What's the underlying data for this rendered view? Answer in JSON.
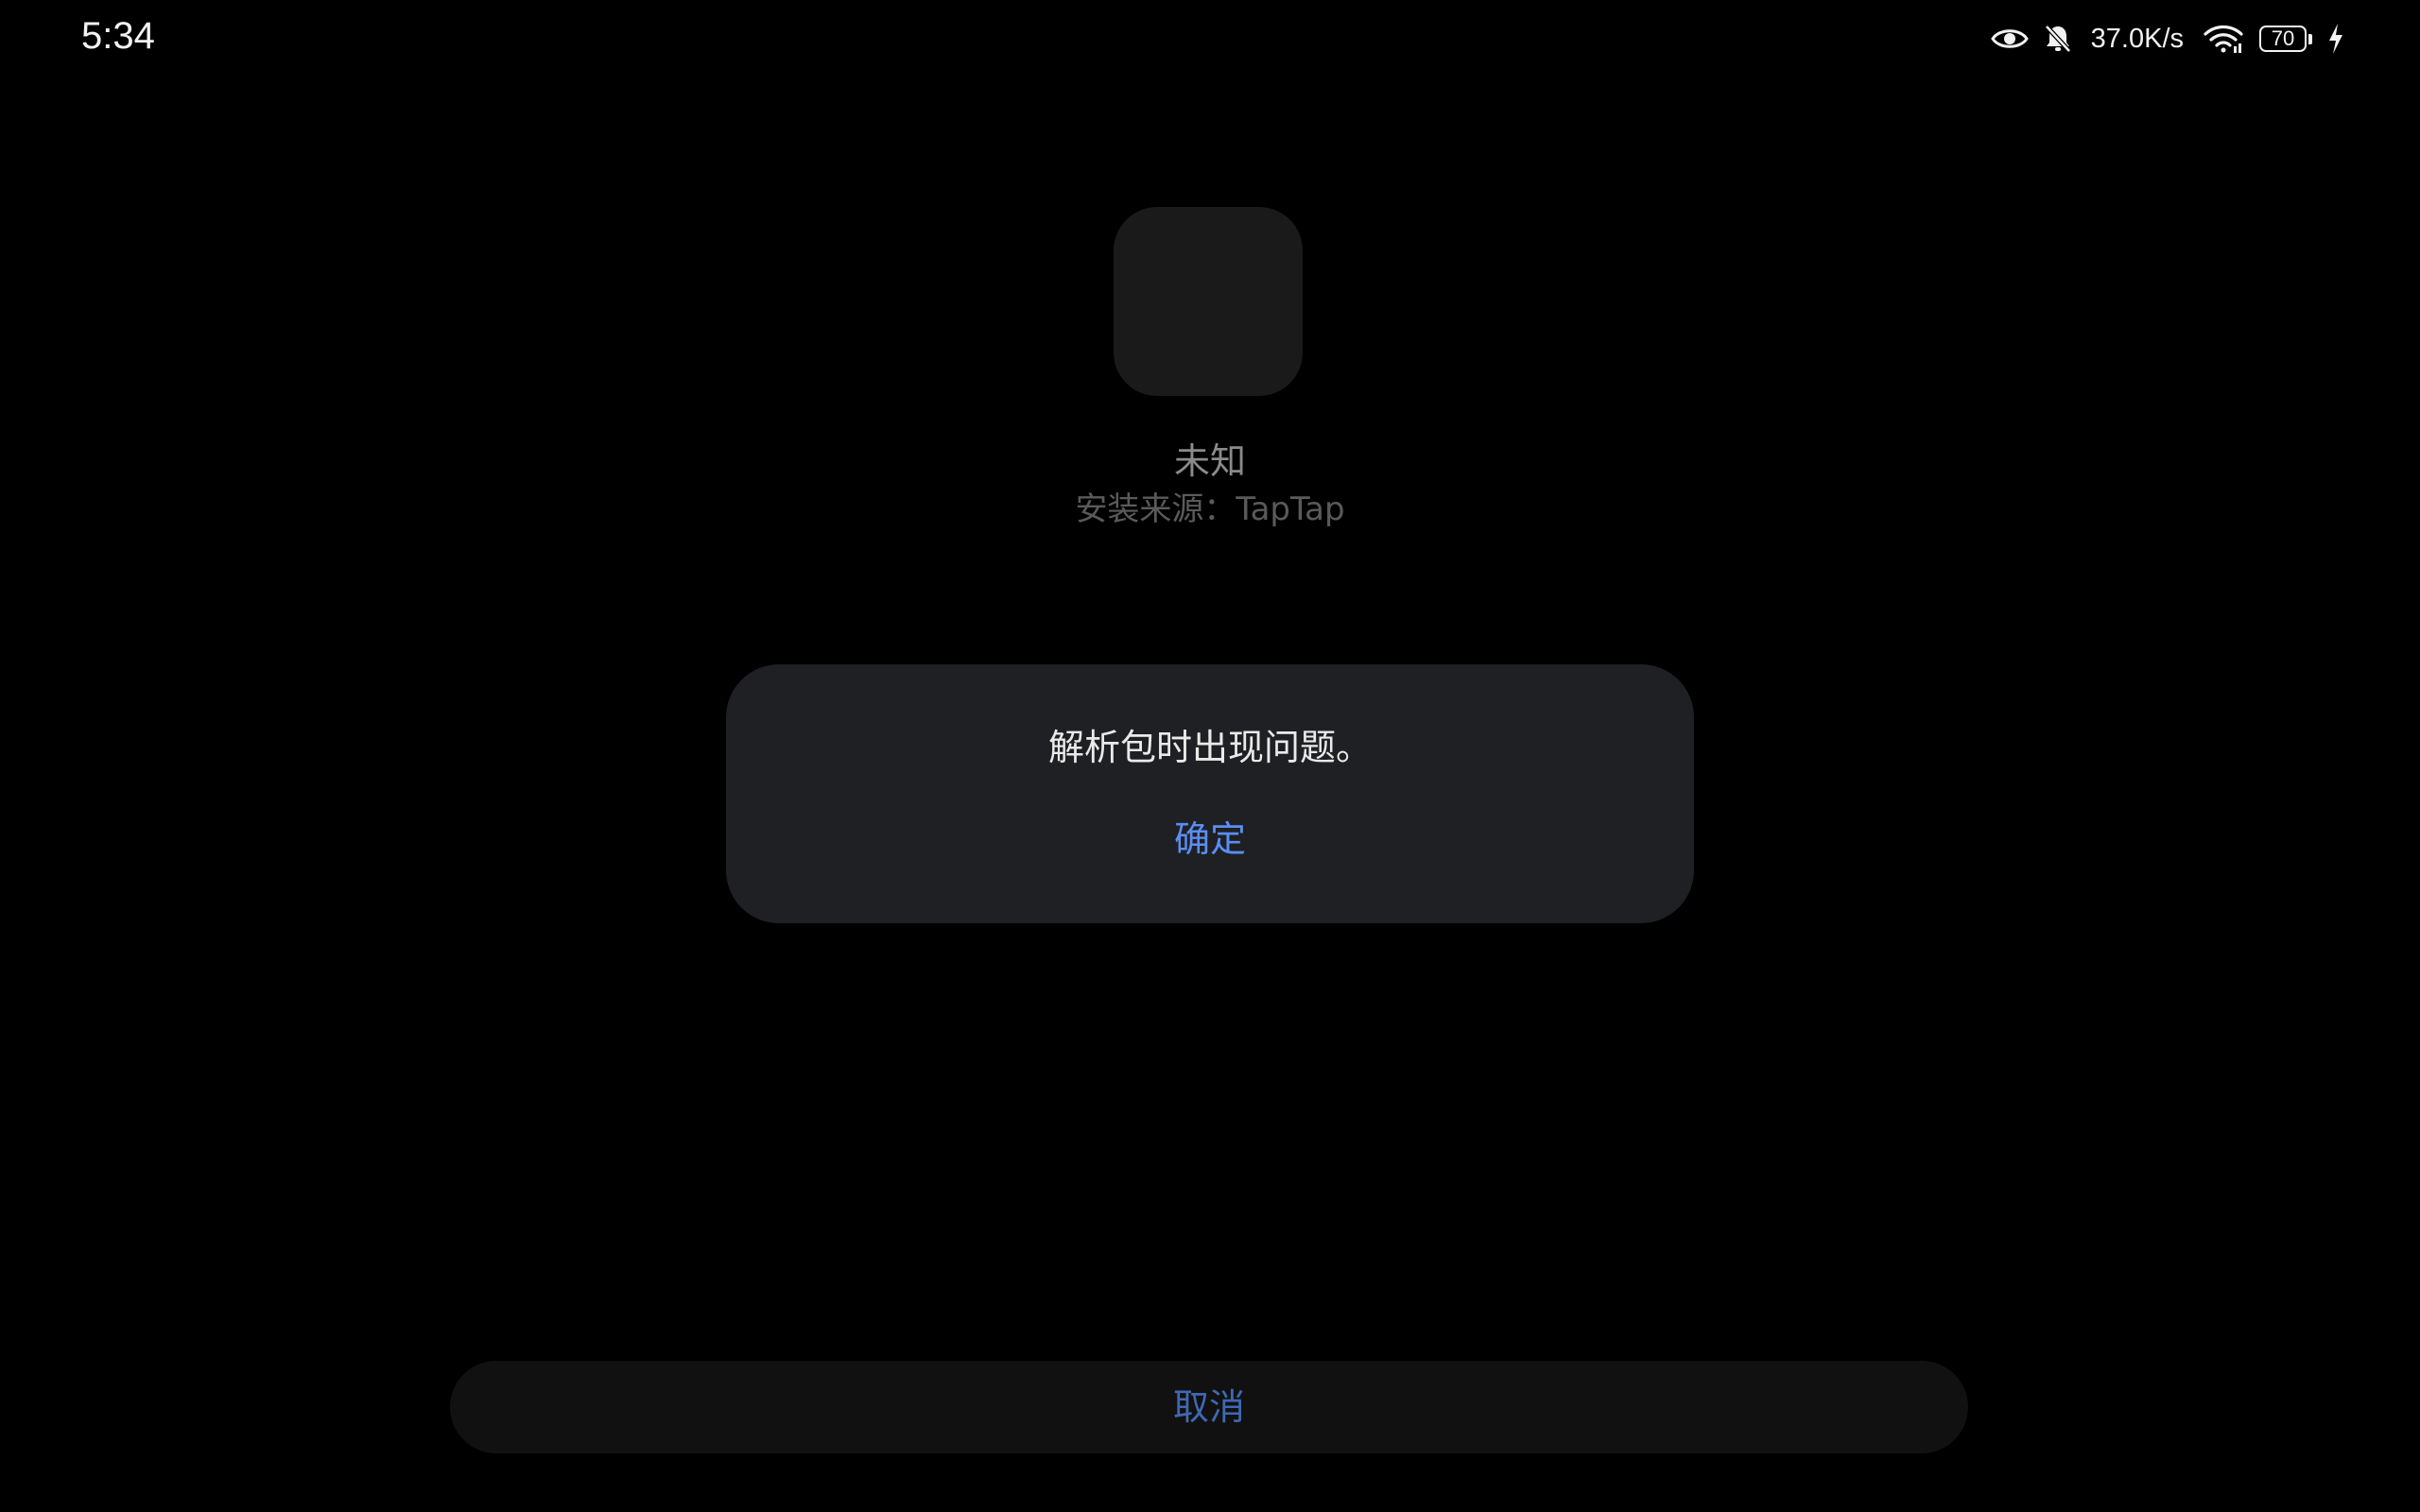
{
  "status_bar": {
    "time": "5:34",
    "icons": [
      "eye-icon",
      "bell-off-icon",
      "wifi-icon",
      "battery-icon",
      "charging-bolt-icon"
    ],
    "net_speed": "37.0K/s",
    "battery_level": "70"
  },
  "app": {
    "name": "未知",
    "install_source": "安装来源：TapTap"
  },
  "dialog": {
    "message": "解析包时出现问题。",
    "confirm_label": "确定"
  },
  "footer": {
    "cancel_label": "取消"
  },
  "colors": {
    "background": "#000000",
    "dialog_bg": "#1f2023",
    "accent": "#5b8ef3",
    "cancel_text": "#3f68b3"
  }
}
